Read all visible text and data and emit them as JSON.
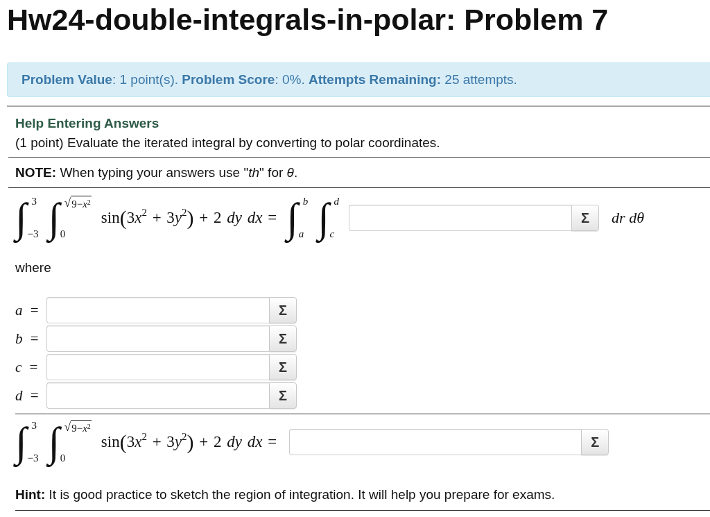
{
  "page_title": "Hw24-double-integrals-in-polar: Problem 7",
  "problem_info": "**Problem Value**: 1 point(s). **Problem Score**: 0%. **Attempts Remaining:** 25 attempts.",
  "problem": {
    "help_link": "Help Entering Answers",
    "statement": "(1 point) Evaluate the iterated integral by converting to polar coordinates.",
    "note": "**NOTE:** When typing your answers use \"*th*\" for *θ*.",
    "equation_1": {
      "integrals": [
        {
          "sign": "∫",
          "upper": {
            "kind": "plain",
            "text": "3"
          },
          "lower": "−3"
        },
        {
          "sign": "∫",
          "upper": {
            "kind": "sqrt",
            "radical": "√",
            "radicand": "9−*x*$^{2}$"
          },
          "lower": "0"
        }
      ],
      "integrand": [
        {
          "kind": "roman",
          "text": "sin"
        },
        {
          "kind": "paren",
          "text": "("
        },
        {
          "kind": "roman",
          "text": "3"
        },
        {
          "kind": "italic",
          "text": "x"
        },
        {
          "kind": "sup",
          "text": "2"
        },
        {
          "kind": "roman",
          "text": " + 3"
        },
        {
          "kind": "italic",
          "text": "y"
        },
        {
          "kind": "sup",
          "text": "2"
        },
        {
          "kind": "paren",
          "text": ")"
        },
        {
          "kind": "roman",
          "text": " + 2 "
        },
        {
          "kind": "italic",
          "text": "dy dx"
        },
        {
          "kind": "roman",
          "text": " ="
        }
      ],
      "polar_integrals": [
        {
          "sign": "∫",
          "upper": {
            "kind": "plain",
            "text": "*b*"
          },
          "lower": "*a*"
        },
        {
          "sign": "∫",
          "upper": {
            "kind": "plain",
            "text": "*d*"
          },
          "lower": "*c*"
        }
      ],
      "answer_button": "Σ",
      "differentials": "dr dθ"
    },
    "where": "where",
    "bounds": [
      {
        "label": "*a* =",
        "button": "Σ"
      },
      {
        "label": "*b* =",
        "button": "Σ"
      },
      {
        "label": "*c* =",
        "button": "Σ"
      },
      {
        "label": "*d* =",
        "button": "Σ"
      }
    ],
    "equation_2": {
      "integrals": [
        {
          "sign": "∫",
          "upper": {
            "kind": "plain",
            "text": "3"
          },
          "lower": "−3"
        },
        {
          "sign": "∫",
          "upper": {
            "kind": "sqrt",
            "radical": "√",
            "radicand": "9−*x*$^{2}$"
          },
          "lower": "0"
        }
      ],
      "integrand": [
        {
          "kind": "roman",
          "text": "sin"
        },
        {
          "kind": "paren",
          "text": "("
        },
        {
          "kind": "roman",
          "text": "3"
        },
        {
          "kind": "italic",
          "text": "x"
        },
        {
          "kind": "sup",
          "text": "2"
        },
        {
          "kind": "roman",
          "text": " + 3"
        },
        {
          "kind": "italic",
          "text": "y"
        },
        {
          "kind": "sup",
          "text": "2"
        },
        {
          "kind": "paren",
          "text": ")"
        },
        {
          "kind": "roman",
          "text": " + 2 "
        },
        {
          "kind": "italic",
          "text": "dy dx"
        },
        {
          "kind": "roman",
          "text": " ="
        }
      ],
      "answer_button": "Σ"
    },
    "hint": "**Hint:** It is good practice to sketch the region of integration. It will help you prepare for exams."
  }
}
